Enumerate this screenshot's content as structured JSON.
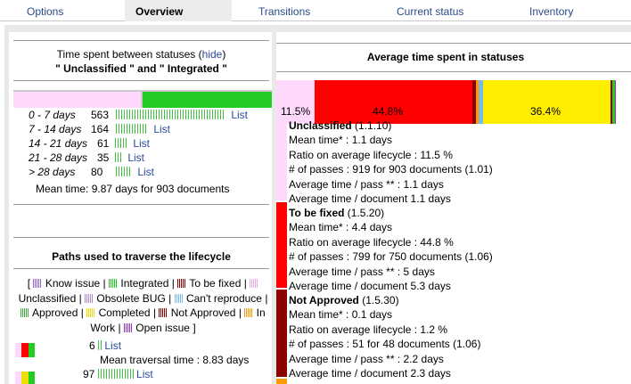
{
  "tabs": [
    "Options",
    "Overview",
    "Transitions",
    "Current status",
    "Inventory"
  ],
  "left": {
    "title_prefix": "Time spent between statuses (",
    "hide_link": "hide",
    "title_suffix": ")",
    "title_line2": "\" Unclassified \" and \" Integrated \"",
    "rows": [
      {
        "range": "0 - 7 days",
        "count": "563",
        "link": "List"
      },
      {
        "range": "7 - 14 days",
        "count": "164",
        "link": "List"
      },
      {
        "range": "14 - 21 days",
        "count": "61",
        "link": "List"
      },
      {
        "range": "21 - 28 days",
        "count": "35",
        "link": "List"
      },
      {
        "range": "> 28 days",
        "count": "80",
        "link": "List"
      }
    ],
    "mean_time": "Mean time: 9.87 days for 903 documents",
    "paths_title": "Paths used to traverse the lifecycle",
    "legend": [
      "[",
      "Know issue",
      "|",
      "Integrated",
      "|",
      "To be fixed",
      "|",
      "Unclassified",
      "|",
      "Obsolete BUG",
      "|",
      "Can't reproduce",
      "|",
      "Approved",
      "|",
      "Completed",
      "|",
      "Not Approved",
      "|",
      "In Work",
      "|",
      "Open issue",
      "]"
    ],
    "path_rows": [
      {
        "count": "6",
        "link": "List"
      },
      {
        "count": "97",
        "link": "List"
      }
    ],
    "mean_traversal": "Mean traversal time : 8.83 days"
  },
  "right": {
    "title": "Average time spent in statuses",
    "bar_labels": [
      "11.5%",
      "44.8%",
      "36.4%"
    ],
    "stats": [
      {
        "name": "Unclassified",
        "code": "(1.1.10)",
        "lines": [
          "Mean time* : 1.1 days",
          "Ratio on average lifecycle : 11.5 %",
          "# of passes : 919 for 903 documents (1.01)",
          "Average time / pass ** : 1.1 days",
          "Average time / document 1.1 days"
        ]
      },
      {
        "name": "To be fixed",
        "code": "(1.5.20)",
        "lines": [
          "Mean time* : 4.4 days",
          "Ratio on average lifecycle : 44.8 %",
          "# of passes : 799 for 750 documents (1.06)",
          "Average time / pass ** : 5 days",
          "Average time / document 5.3 days"
        ]
      },
      {
        "name": "Not Approved",
        "code": "(1.5.30)",
        "lines": [
          "Mean time* : 0.1 days",
          "Ratio on average lifecycle : 1.2 %",
          "# of passes : 51 for 48 documents (1.06)",
          "Average time / pass ** : 2.2 days",
          "Average time / document 2.3 days"
        ]
      }
    ]
  },
  "histogram": {
    "ticks": [
      563,
      164,
      61,
      35,
      80
    ]
  },
  "colors": {
    "unclassified": "#ffd9fb",
    "to_be_fixed": "#ff0000",
    "not_approved": "#8b0000",
    "completed": "#ffee00",
    "integrated": "#22cc22",
    "cant_reproduce": "#77bbee",
    "orange": "#ff9900"
  }
}
